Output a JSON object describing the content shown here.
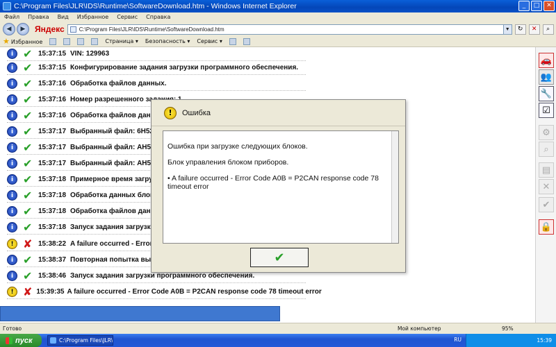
{
  "window": {
    "title": "C:\\Program Files\\JLR\\IDS\\Runtime\\SoftwareDownload.htm - Windows Internet Explorer",
    "address": "C:\\Program Files\\JLR\\IDS\\Runtime\\SoftwareDownload.htm",
    "search_brand": "Яндекс"
  },
  "menu": [
    "Файл",
    "Правка",
    "Вид",
    "Избранное",
    "Сервис",
    "Справка"
  ],
  "favbar": {
    "favorites": "Избранное",
    "page": "Страница ▾",
    "security": "Безопасность ▾",
    "service": "Сервис ▾"
  },
  "log": [
    {
      "status": "info",
      "result": "ok",
      "time": "15:37:15",
      "text": "VIN: 129963"
    },
    {
      "status": "info",
      "result": "ok",
      "time": "15:37:15",
      "text": "Конфигурирование задания загрузки программного обеспечения."
    },
    {
      "status": "info",
      "result": "ok",
      "time": "15:37:16",
      "text": "Обработка файлов данных."
    },
    {
      "status": "info",
      "result": "ok",
      "time": "15:37:16",
      "text": "Номер разрешенного задания: 1"
    },
    {
      "status": "info",
      "result": "ok",
      "time": "15:37:16",
      "text": "Обработка файлов данны"
    },
    {
      "status": "info",
      "result": "ok",
      "time": "15:37:17",
      "text": "Выбранный файл: 6H52-1"
    },
    {
      "status": "info",
      "result": "ok",
      "time": "15:37:17",
      "text": "Выбранный файл: AH52-1"
    },
    {
      "status": "info",
      "result": "ok",
      "time": "15:37:17",
      "text": "Выбранный файл: AH52-1"
    },
    {
      "status": "info",
      "result": "ok",
      "time": "15:37:18",
      "text": "Примерное время загрузк"
    },
    {
      "status": "info",
      "result": "ok",
      "time": "15:37:18",
      "text": "Обработка данных блоко"
    },
    {
      "status": "info",
      "result": "ok",
      "time": "15:37:18",
      "text": "Обработка файлов данны"
    },
    {
      "status": "info",
      "result": "ok",
      "time": "15:37:18",
      "text": "Запуск задания загрузки п"
    },
    {
      "status": "warn",
      "result": "err",
      "time": "15:38:22",
      "text": "A failure occurred - Error C"
    },
    {
      "status": "info",
      "result": "ok",
      "time": "15:38:37",
      "text": "Повторная попытка выбр"
    },
    {
      "status": "info",
      "result": "ok",
      "time": "15:38:46",
      "text": "Запуск задания загрузки программного обеспечения."
    },
    {
      "status": "warn",
      "result": "err",
      "time": "15:39:35",
      "text": "A failure occurred - Error Code A0B = P2CAN response code 78 timeout error"
    }
  ],
  "dialog": {
    "title": "Ошибка",
    "line1": "Ошибка при загрузке следующих блоков.",
    "line2": "Блок управления блоком приборов.",
    "line3": "• A failure occurred - Error Code A0B = P2CAN response code 78 timeout error",
    "ok_glyph": "✔"
  },
  "status": {
    "left": "Готово",
    "zone": "Мой компьютер",
    "zoom": "95%"
  },
  "taskbar": {
    "start": "пуск",
    "task": "C:\\Program Files\\JLR\\...",
    "lang": "RU",
    "clock": "15:39"
  }
}
